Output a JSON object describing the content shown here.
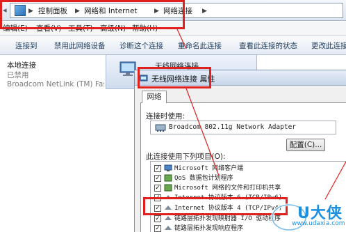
{
  "address_bar": {
    "crumbs": [
      "控制面板",
      "网络和 Internet",
      "网络连接"
    ]
  },
  "menu": {
    "items": [
      "编辑(E)",
      "查看(V)",
      "工具(T)",
      "高级(N)",
      "帮助(H)"
    ]
  },
  "toolbar": {
    "items": [
      "连接到",
      "禁用此网络设备",
      "诊断这个连接",
      "重命名此连接",
      "查看此连接的状态",
      "更改此连接"
    ]
  },
  "left_connection": {
    "name": "本地连接",
    "status": "已禁用",
    "adapter": "Broadcom NetLink (TM) Fast E"
  },
  "wireless_tile": {
    "label": "无线网络连接"
  },
  "dialog": {
    "title": "无线网络连接 属性",
    "tab": "网络",
    "connect_using_label": "连接时使用:",
    "adapter": "Broadcom 802.11g Network Adapter",
    "configure_button": "配置(C)...",
    "items_label": "此连接使用下列项目(O):",
    "items": [
      {
        "label": "Microsoft 网络客户端",
        "checked": true,
        "icon": "network-client-icon"
      },
      {
        "label": "QoS 数据包计划程序",
        "checked": true,
        "icon": "qos-icon"
      },
      {
        "label": "Microsoft 网络的文件和打印机共享",
        "checked": true,
        "icon": "share-icon"
      },
      {
        "label": "Internet 协议版本 6 (TCP/IPv6)",
        "checked": true,
        "icon": "protocol-icon"
      },
      {
        "label": "Internet 协议版本 4 (TCP/IPv4)",
        "checked": true,
        "icon": "protocol-icon"
      },
      {
        "label": "链路层拓扑发现映射器 I/O 驱动程序",
        "checked": true,
        "icon": "protocol-icon"
      },
      {
        "label": "链路层拓扑发现响应程序",
        "checked": true,
        "icon": "protocol-icon"
      }
    ]
  },
  "watermark": {
    "brand": "U大侠",
    "url": "www.udaxia.com"
  },
  "colors": {
    "highlight": "#e0201c",
    "watermark": "#1b8fe0"
  }
}
